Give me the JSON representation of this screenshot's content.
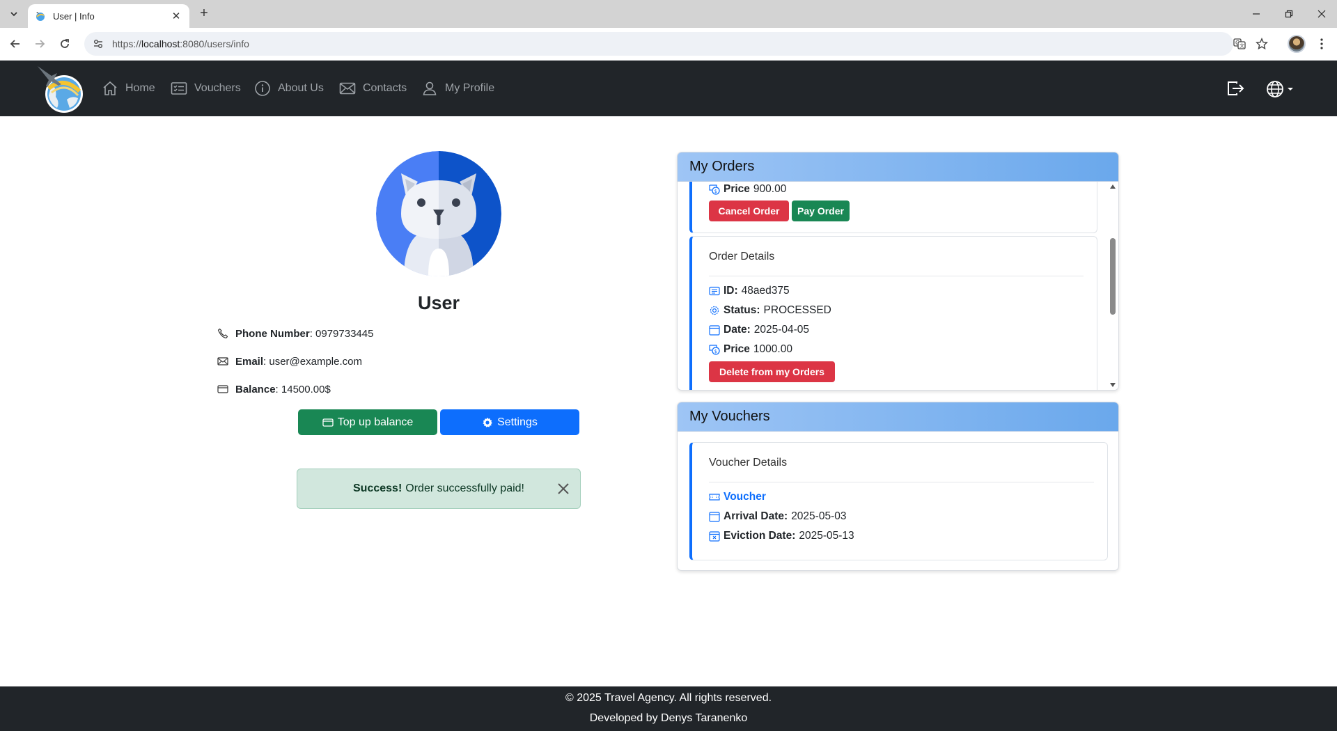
{
  "browser": {
    "tab_title": "User | Info",
    "url_prefix": "https://",
    "url_host": "localhost",
    "url_path": ":8080/users/info"
  },
  "navbar": {
    "items": [
      {
        "label": "Home",
        "icon": "home-icon"
      },
      {
        "label": "Vouchers",
        "icon": "vouchers-icon"
      },
      {
        "label": "About Us",
        "icon": "info-icon"
      },
      {
        "label": "Contacts",
        "icon": "envelope-icon"
      },
      {
        "label": "My Profile",
        "icon": "person-icon"
      }
    ]
  },
  "profile": {
    "name": "User",
    "phone_label": "Phone Number",
    "phone": "0979733445",
    "email_label": "Email",
    "email": "user@example.com",
    "balance_label": "Balance",
    "balance": "14500.00$",
    "topup_label": "Top up balance",
    "settings_label": "Settings"
  },
  "alert": {
    "strong": "Success!",
    "message": "Order successfully paid!"
  },
  "orders": {
    "title": "My Orders",
    "first": {
      "price_label": "Price",
      "price": "900.00",
      "cancel_label": "Cancel Order",
      "pay_label": "Pay Order"
    },
    "second": {
      "title": "Order Details",
      "id_label": "ID:",
      "id": "48aed375",
      "status_label": "Status:",
      "status": "PROCESSED",
      "date_label": "Date:",
      "date": "2025-04-05",
      "price_label": "Price",
      "price": "1000.00",
      "delete_label": "Delete from my Orders"
    }
  },
  "vouchers": {
    "title": "My Vouchers",
    "card_title": "Voucher Details",
    "link": "Voucher",
    "arrival_label": "Arrival Date:",
    "arrival": "2025-05-03",
    "eviction_label": "Eviction Date:",
    "eviction": "2025-05-13"
  },
  "footer": {
    "line1": "© 2025 Travel Agency. All rights reserved.",
    "line2": "Developed by Denys Taranenko"
  },
  "colors": {
    "navbar": "#212529",
    "primary": "#0d6efd",
    "success": "#198754",
    "danger": "#dc3545",
    "alert_bg": "#d1e7dd"
  }
}
